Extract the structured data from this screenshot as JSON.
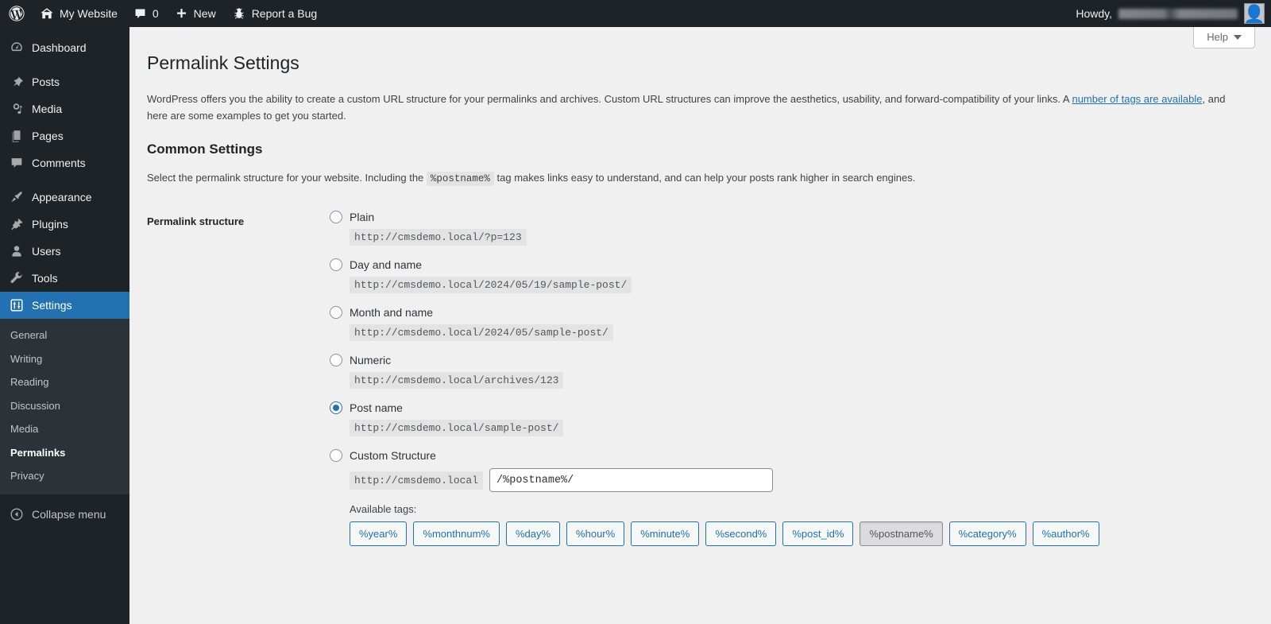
{
  "adminbar": {
    "logo_icon": "wordpress-logo-icon",
    "site_icon": "home-icon",
    "site_name": "My Website",
    "comments_icon": "comment-bubble-icon",
    "comments_count": "0",
    "new_icon": "plus-icon",
    "new_label": "New",
    "bug_icon": "bug-icon",
    "bug_label": "Report a Bug",
    "howdy_label": "Howdy,",
    "user_name_redacted": true,
    "avatar_icon": "user-avatar-icon"
  },
  "sidebar": {
    "items": [
      {
        "label": "Dashboard",
        "icon": "dashboard-icon",
        "current": false
      },
      {
        "label": "Posts",
        "icon": "pin-icon",
        "current": false
      },
      {
        "label": "Media",
        "icon": "media-icon",
        "current": false
      },
      {
        "label": "Pages",
        "icon": "pages-icon",
        "current": false
      },
      {
        "label": "Comments",
        "icon": "comment-bubble-icon",
        "current": false
      },
      {
        "label": "Appearance",
        "icon": "paintbrush-icon",
        "current": false
      },
      {
        "label": "Plugins",
        "icon": "plug-icon",
        "current": false
      },
      {
        "label": "Users",
        "icon": "user-icon",
        "current": false
      },
      {
        "label": "Tools",
        "icon": "wrench-icon",
        "current": false
      },
      {
        "label": "Settings",
        "icon": "settings-sliders-icon",
        "current": true
      }
    ],
    "submenu": [
      {
        "label": "General",
        "current": false
      },
      {
        "label": "Writing",
        "current": false
      },
      {
        "label": "Reading",
        "current": false
      },
      {
        "label": "Discussion",
        "current": false
      },
      {
        "label": "Media",
        "current": false
      },
      {
        "label": "Permalinks",
        "current": true
      },
      {
        "label": "Privacy",
        "current": false
      }
    ],
    "collapse_label": "Collapse menu",
    "collapse_icon": "collapse-arrow-left-icon"
  },
  "screen_meta": {
    "help_label": "Help",
    "help_caret_icon": "chevron-down-icon"
  },
  "main": {
    "page_title": "Permalink Settings",
    "intro_part1": "WordPress offers you the ability to create a custom URL structure for your permalinks and archives. Custom URL structures can improve the aesthetics, usability, and forward-compatibility of your links. A ",
    "intro_link": "number of tags are available",
    "intro_part2": ", and here are some examples to get you started.",
    "section_title": "Common Settings",
    "section_desc_part1": "Select the permalink structure for your website. Including the ",
    "section_desc_code": "%postname%",
    "section_desc_part2": " tag makes links easy to understand, and can help your posts rank higher in search engines.",
    "field_label": "Permalink structure",
    "options": [
      {
        "label": "Plain",
        "example": "http://cmsdemo.local/?p=123",
        "selected": false
      },
      {
        "label": "Day and name",
        "example": "http://cmsdemo.local/2024/05/19/sample-post/",
        "selected": false
      },
      {
        "label": "Month and name",
        "example": "http://cmsdemo.local/2024/05/sample-post/",
        "selected": false
      },
      {
        "label": "Numeric",
        "example": "http://cmsdemo.local/archives/123",
        "selected": false
      },
      {
        "label": "Post name",
        "example": "http://cmsdemo.local/sample-post/",
        "selected": true
      }
    ],
    "custom": {
      "label": "Custom Structure",
      "selected": false,
      "prefix": "http://cmsdemo.local",
      "value": "/%postname%/"
    },
    "available_tags_label": "Available tags:",
    "tags": [
      {
        "label": "%year%",
        "used": false
      },
      {
        "label": "%monthnum%",
        "used": false
      },
      {
        "label": "%day%",
        "used": false
      },
      {
        "label": "%hour%",
        "used": false
      },
      {
        "label": "%minute%",
        "used": false
      },
      {
        "label": "%second%",
        "used": false
      },
      {
        "label": "%post_id%",
        "used": false
      },
      {
        "label": "%postname%",
        "used": true
      },
      {
        "label": "%category%",
        "used": false
      },
      {
        "label": "%author%",
        "used": false
      }
    ]
  },
  "colors": {
    "accent": "#2271b1",
    "admin_bg": "#1d2327",
    "submenu_bg": "#2c3338",
    "content_bg": "#f0f0f1"
  }
}
